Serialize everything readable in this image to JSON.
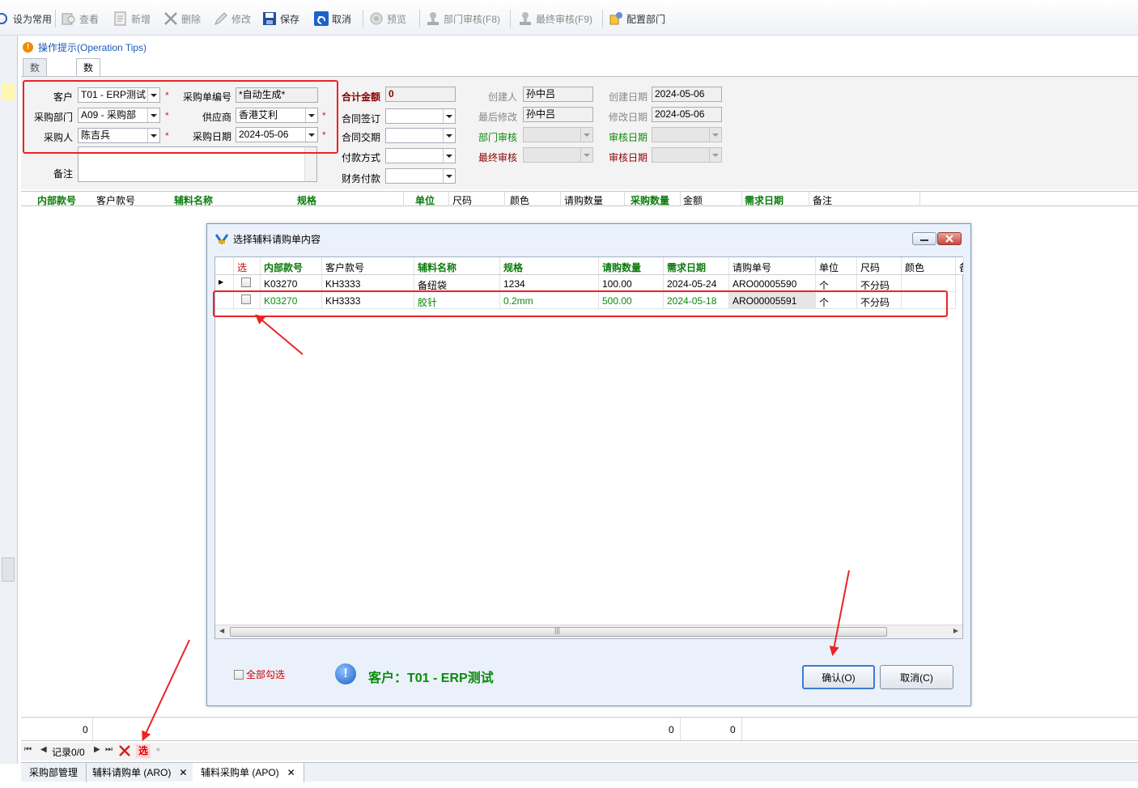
{
  "toolbar": {
    "set_common": "设为常用",
    "view": "查看",
    "new": "新增",
    "delete": "删除",
    "edit": "修改",
    "save": "保存",
    "cancel": "取消",
    "preview": "预览",
    "dept_audit": "部门审核(F8)",
    "final_audit": "最终审核(F9)",
    "config_dept": "配置部门"
  },
  "tips": {
    "text": "操作提示(Operation Tips)"
  },
  "tabs": {
    "query": "数据查询",
    "edit": "数据编辑"
  },
  "form": {
    "customer_label": "客户",
    "customer_value": "T01 - ERP测试",
    "po_no_label": "采购单编号",
    "po_no_value": "*自动生成*",
    "dept_label": "采购部门",
    "dept_value": "A09 - 采购部",
    "supplier_label": "供应商",
    "supplier_value": "香港艾利",
    "buyer_label": "采购人",
    "buyer_value": "陈吉兵",
    "date_label": "采购日期",
    "date_value": "2024-05-06",
    "remark_label": "备注",
    "total_label": "合计金额",
    "total_value": "0",
    "contract_sign_label": "合同签订",
    "contract_delivery_label": "合同交期",
    "payment_method_label": "付款方式",
    "finance_pay_label": "财务付款",
    "creator_label": "创建人",
    "creator_value": "孙中吕",
    "create_date_label": "创建日期",
    "create_date_value": "2024-05-06",
    "last_modifier_label": "最后修改",
    "last_modifier_value": "孙中吕",
    "modify_date_label": "修改日期",
    "modify_date_value": "2024-05-06",
    "dept_audit_label": "部门审核",
    "audit_date_label": "审核日期",
    "final_audit_label": "最终审核",
    "audit_date2_label": "审核日期",
    "required_mark": "*"
  },
  "grid": {
    "columns": [
      "内部款号",
      "客户款号",
      "辅料名称",
      "规格",
      "单位",
      "尺码",
      "颜色",
      "请购数量",
      "采购数量",
      "金额",
      "需求日期",
      "备注"
    ]
  },
  "summary": {
    "sum1": "0",
    "sum2": "0",
    "sum3": "0"
  },
  "nav": {
    "record": "记录0/0",
    "select": "选"
  },
  "bottom_tabs": [
    "采购部管理",
    "辅料请购单 (ARO)",
    "辅料采购单 (APO)"
  ],
  "dialog": {
    "title": "选择辅料请购单内容",
    "columns": [
      "选",
      "内部款号",
      "客户款号",
      "辅料名称",
      "规格",
      "请购数量",
      "需求日期",
      "请购单号",
      "单位",
      "尺码",
      "颜色",
      "备"
    ],
    "rows": [
      {
        "inner_no": "K03270",
        "cust_no": "KH3333",
        "name": "备纽袋",
        "spec": "1234",
        "qty": "100.00",
        "date": "2024-05-24",
        "req_no": "ARO00005590",
        "unit": "个",
        "size": "不分码",
        "color": ""
      },
      {
        "inner_no": "K03270",
        "cust_no": "KH3333",
        "name": "胶针",
        "spec": "0.2mm",
        "qty": "500.00",
        "date": "2024-05-18",
        "req_no": "ARO00005591",
        "unit": "个",
        "size": "不分码",
        "color": ""
      }
    ],
    "select_all": "全部勾选",
    "customer_info": "客户：T01 - ERP测试",
    "confirm": "确认(O)",
    "cancel": "取消(C)"
  }
}
